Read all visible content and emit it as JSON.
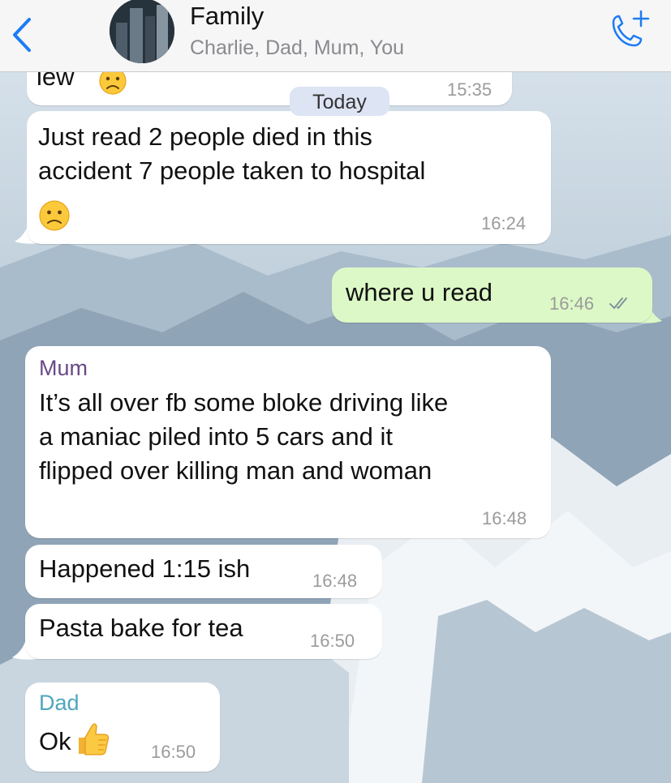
{
  "header": {
    "title": "Family",
    "members": "Charlie, Dad, Mum, You"
  },
  "date_separator": "Today",
  "messages": [
    {
      "direction": "incoming",
      "text": "iew",
      "time": "15:35",
      "emoji": "frowning-face"
    },
    {
      "direction": "incoming",
      "text": "Just read 2 people died in this\naccident 7 people taken to hospital",
      "time": "16:24",
      "emoji": "slightly-frowning-face"
    },
    {
      "direction": "outgoing",
      "text": "where u read",
      "time": "16:46",
      "status": "read"
    },
    {
      "direction": "incoming",
      "sender": "Mum",
      "text": "It’s all over fb some bloke driving like\na maniac piled into 5 cars and it\nflipped over killing man and woman",
      "time": "16:48"
    },
    {
      "direction": "incoming",
      "text": "Happened 1:15 ish",
      "time": "16:48"
    },
    {
      "direction": "incoming",
      "text": "Pasta bake for tea",
      "time": "16:50"
    },
    {
      "direction": "incoming",
      "sender": "Dad",
      "text": "Ok",
      "time": "16:50",
      "emoji": "thumbs-up"
    }
  ],
  "colors": {
    "header_bg": "#f6f6f7",
    "accent": "#1c7cf4",
    "incoming_bubble": "#ffffff",
    "outgoing_bubble": "#dcf8c6",
    "sender_mum": "#6a4a86",
    "sender_dad": "#4ea6bd",
    "read_ticks": "#7d8b97"
  },
  "icons": {
    "back": "chevron-left-icon",
    "call": "add-call-icon"
  }
}
